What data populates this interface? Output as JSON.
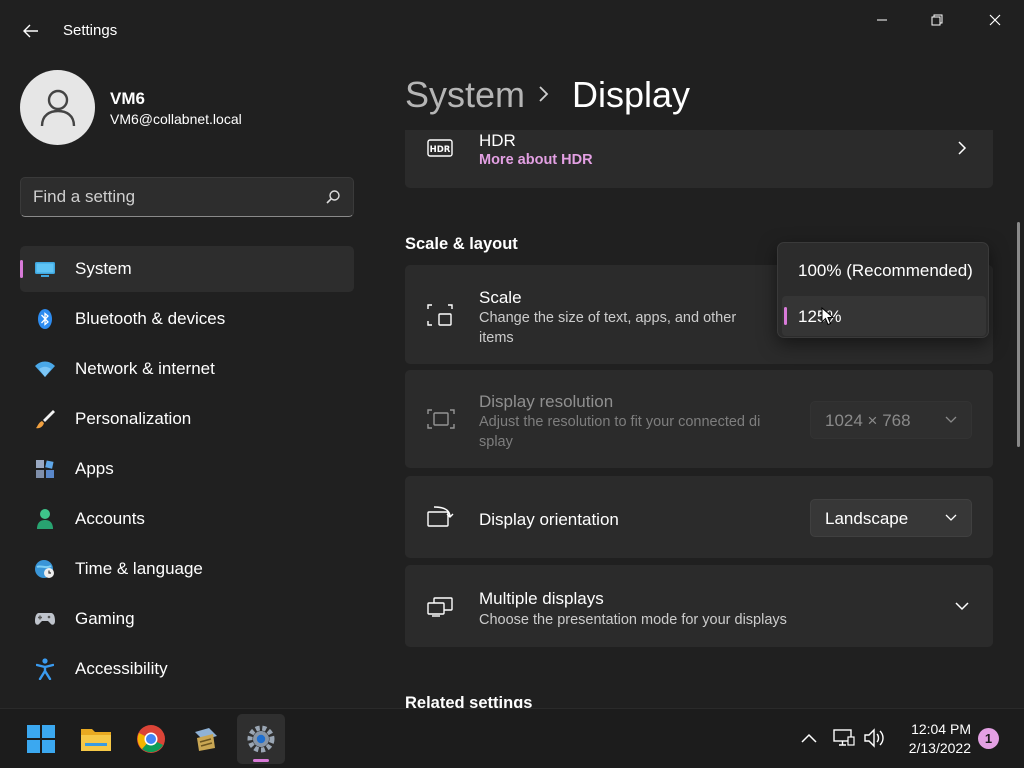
{
  "window": {
    "title": "Settings"
  },
  "profile": {
    "name": "VM6",
    "email": "VM6@collabnet.local"
  },
  "search": {
    "placeholder": "Find a setting"
  },
  "sidebar": {
    "items": [
      {
        "label": "System",
        "icon": "system-monitor-icon",
        "active": true
      },
      {
        "label": "Bluetooth & devices",
        "icon": "bluetooth-icon"
      },
      {
        "label": "Network & internet",
        "icon": "wifi-icon"
      },
      {
        "label": "Personalization",
        "icon": "paintbrush-icon"
      },
      {
        "label": "Apps",
        "icon": "apps-icon"
      },
      {
        "label": "Accounts",
        "icon": "person-icon"
      },
      {
        "label": "Time & language",
        "icon": "globe-clock-icon"
      },
      {
        "label": "Gaming",
        "icon": "gamepad-icon"
      },
      {
        "label": "Accessibility",
        "icon": "accessibility-icon"
      }
    ]
  },
  "header": {
    "parent": "System",
    "current": "Display"
  },
  "content": {
    "hdr": {
      "title": "HDR",
      "link": "More about HDR"
    },
    "scale_layout_title": "Scale & layout",
    "scale": {
      "title": "Scale",
      "subtitle_line1": "Change the size of text, apps, and other",
      "subtitle_line2": "items"
    },
    "resolution": {
      "title": "Display resolution",
      "subtitle_line1": "Adjust the resolution to fit your connected di",
      "subtitle_line2": "splay",
      "value": "1024 × 768"
    },
    "orientation": {
      "title": "Display orientation",
      "value": "Landscape"
    },
    "multiple": {
      "title": "Multiple displays",
      "subtitle": "Choose the presentation mode for your displays"
    },
    "related_title": "Related settings"
  },
  "scale_popup": {
    "options": [
      "100% (Recommended)",
      "125%"
    ],
    "selected_index": 1
  },
  "taskbar": {
    "apps": [
      "start-icon",
      "file-explorer-icon",
      "chrome-icon",
      "app-icon",
      "settings-icon"
    ],
    "time": "12:04 PM",
    "date": "2/13/2022",
    "notifications": "1"
  },
  "colors": {
    "accent": "#d87ad8",
    "link": "#e3a0e3",
    "background": "#202020",
    "card": "#2b2b2b"
  }
}
